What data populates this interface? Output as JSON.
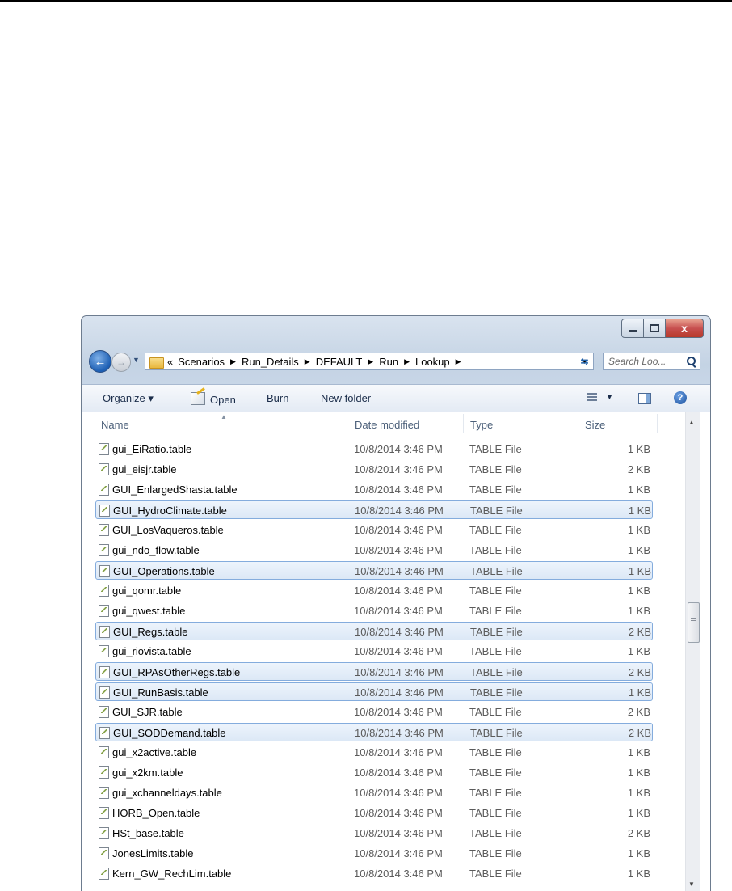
{
  "window": {
    "caption_close": "x",
    "breadcrumb": [
      "«",
      "Scenarios",
      "Run_Details",
      "DEFAULT",
      "Run",
      "Lookup"
    ],
    "search_placeholder": "Search Loo..."
  },
  "toolbar": {
    "organize_label": "Organize ▾",
    "open_label": "Open",
    "burn_label": "Burn",
    "new_folder_label": "New folder",
    "help_label": "?"
  },
  "columns": {
    "name": "Name",
    "date": "Date modified",
    "type": "Type",
    "size": "Size"
  },
  "files": [
    {
      "name": "gui_EiRatio.table",
      "date": "10/8/2014 3:46 PM",
      "type": "TABLE File",
      "size": "1 KB",
      "selected": false
    },
    {
      "name": "gui_eisjr.table",
      "date": "10/8/2014 3:46 PM",
      "type": "TABLE File",
      "size": "2 KB",
      "selected": false
    },
    {
      "name": "GUI_EnlargedShasta.table",
      "date": "10/8/2014 3:46 PM",
      "type": "TABLE File",
      "size": "1 KB",
      "selected": false
    },
    {
      "name": "GUI_HydroClimate.table",
      "date": "10/8/2014 3:46 PM",
      "type": "TABLE File",
      "size": "1 KB",
      "selected": true
    },
    {
      "name": "GUI_LosVaqueros.table",
      "date": "10/8/2014 3:46 PM",
      "type": "TABLE File",
      "size": "1 KB",
      "selected": false
    },
    {
      "name": "gui_ndo_flow.table",
      "date": "10/8/2014 3:46 PM",
      "type": "TABLE File",
      "size": "1 KB",
      "selected": false
    },
    {
      "name": "GUI_Operations.table",
      "date": "10/8/2014 3:46 PM",
      "type": "TABLE File",
      "size": "1 KB",
      "selected": true
    },
    {
      "name": "gui_qomr.table",
      "date": "10/8/2014 3:46 PM",
      "type": "TABLE File",
      "size": "1 KB",
      "selected": false
    },
    {
      "name": "gui_qwest.table",
      "date": "10/8/2014 3:46 PM",
      "type": "TABLE File",
      "size": "1 KB",
      "selected": false
    },
    {
      "name": "GUI_Regs.table",
      "date": "10/8/2014 3:46 PM",
      "type": "TABLE File",
      "size": "2 KB",
      "selected": true
    },
    {
      "name": "gui_riovista.table",
      "date": "10/8/2014 3:46 PM",
      "type": "TABLE File",
      "size": "1 KB",
      "selected": false
    },
    {
      "name": "GUI_RPAsOtherRegs.table",
      "date": "10/8/2014 3:46 PM",
      "type": "TABLE File",
      "size": "2 KB",
      "selected": true
    },
    {
      "name": "GUI_RunBasis.table",
      "date": "10/8/2014 3:46 PM",
      "type": "TABLE File",
      "size": "1 KB",
      "selected": true
    },
    {
      "name": "GUI_SJR.table",
      "date": "10/8/2014 3:46 PM",
      "type": "TABLE File",
      "size": "2 KB",
      "selected": false
    },
    {
      "name": "GUI_SODDemand.table",
      "date": "10/8/2014 3:46 PM",
      "type": "TABLE File",
      "size": "2 KB",
      "selected": true
    },
    {
      "name": "gui_x2active.table",
      "date": "10/8/2014 3:46 PM",
      "type": "TABLE File",
      "size": "1 KB",
      "selected": false
    },
    {
      "name": "gui_x2km.table",
      "date": "10/8/2014 3:46 PM",
      "type": "TABLE File",
      "size": "1 KB",
      "selected": false
    },
    {
      "name": "gui_xchanneldays.table",
      "date": "10/8/2014 3:46 PM",
      "type": "TABLE File",
      "size": "1 KB",
      "selected": false
    },
    {
      "name": "HORB_Open.table",
      "date": "10/8/2014 3:46 PM",
      "type": "TABLE File",
      "size": "1 KB",
      "selected": false
    },
    {
      "name": "HSt_base.table",
      "date": "10/8/2014 3:46 PM",
      "type": "TABLE File",
      "size": "2 KB",
      "selected": false
    },
    {
      "name": "JonesLimits.table",
      "date": "10/8/2014 3:46 PM",
      "type": "TABLE File",
      "size": "1 KB",
      "selected": false
    },
    {
      "name": "Kern_GW_RechLim.table",
      "date": "10/8/2014 3:46 PM",
      "type": "TABLE File",
      "size": "1 KB",
      "selected": false
    }
  ]
}
